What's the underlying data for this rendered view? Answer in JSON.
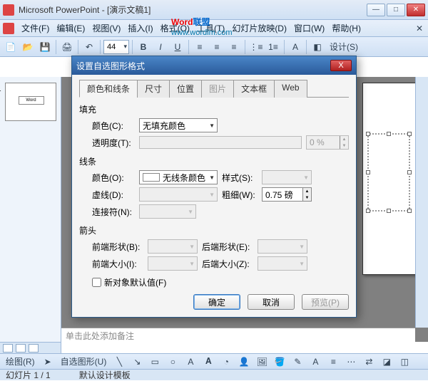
{
  "titlebar": {
    "title": "Microsoft PowerPoint - [演示文稿1]"
  },
  "watermark": {
    "w1": "Word",
    "w2": "联盟",
    "url": "www.wordlm.com"
  },
  "menu": {
    "file": "文件(F)",
    "edit": "编辑(E)",
    "view": "视图(V)",
    "insert": "插入(I)",
    "format": "格式(O)",
    "tools": "工具(T)",
    "slideshow": "幻灯片放映(D)",
    "window": "窗口(W)",
    "help": "帮助(H)"
  },
  "toolbar1": {
    "zoom": "44"
  },
  "toolbar2": {
    "design": "设计(S)"
  },
  "thumb": {
    "text": "Word"
  },
  "notes": {
    "placeholder": "单击此处添加备注"
  },
  "drawbar": {
    "draw": "绘图(R)",
    "autoshape": "自选图形(U)"
  },
  "status": {
    "slide": "幻灯片 1 / 1",
    "template": "默认设计模板"
  },
  "dialog": {
    "title": "设置自选图形格式",
    "tabs": {
      "color": "颜色和线条",
      "size": "尺寸",
      "position": "位置",
      "picture": "图片",
      "textbox": "文本框",
      "web": "Web"
    },
    "fill": {
      "section": "填充",
      "color_label": "颜色(C):",
      "color_value": "无填充颜色",
      "trans_label": "透明度(T):",
      "trans_value": "0 %"
    },
    "line": {
      "section": "线条",
      "color_label": "颜色(O):",
      "color_value": "无线条颜色",
      "style_label": "样式(S):",
      "dash_label": "虚线(D):",
      "weight_label": "粗细(W):",
      "weight_value": "0.75 磅",
      "connector_label": "连接符(N):"
    },
    "arrow": {
      "section": "箭头",
      "begin_style": "前端形状(B):",
      "end_style": "后端形状(E):",
      "begin_size": "前端大小(I):",
      "end_size": "后端大小(Z):"
    },
    "default_cb": "新对象默认值(F)",
    "ok": "确定",
    "cancel": "取消",
    "preview": "预览(P)"
  }
}
